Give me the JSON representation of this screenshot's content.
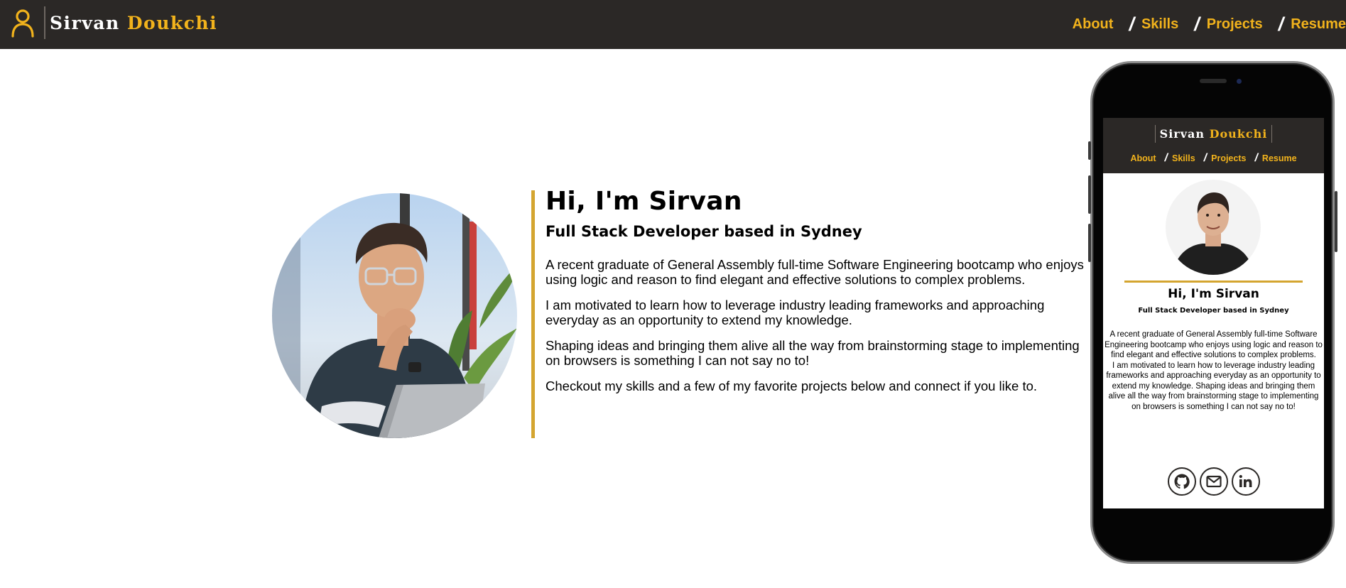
{
  "site": {
    "first_name": "Sirvan",
    "last_name": "Doukchi",
    "brand_icon": "user-icon"
  },
  "nav": {
    "separator": "/",
    "items": [
      {
        "label": "About"
      },
      {
        "label": "Skills"
      },
      {
        "label": "Projects"
      },
      {
        "label": "Resume"
      }
    ]
  },
  "hero": {
    "title": "Hi, I'm Sirvan",
    "subtitle": "Full Stack Developer based in Sydney",
    "paragraphs": [
      "A recent graduate of General Assembly full-time Software Engineering bootcamp who enjoys using logic and reason to find elegant and effective solutions to complex problems.",
      "I am motivated to learn how to leverage industry leading frameworks and approaching everyday as an opportunity to extend my knowledge.",
      "Shaping ideas and bringing them alive all the way from brainstorming stage to implementing on browsers is something I can not say no to!",
      "Checkout my skills and a few of my favorite projects below and connect if you like to."
    ]
  },
  "mobile_preview": {
    "body_line_1": "A recent graduate of General Assembly full-time Software Engineering bootcamp who enjoys using logic and reason to find elegant and effective solutions to complex problems.",
    "body_line_2": "I am motivated to learn how to leverage industry leading frameworks and approaching everyday as an opportunity to extend my knowledge. Shaping ideas and bringing them alive all the way from brainstorming stage to implementing on browsers is something I can not say no to!",
    "socials": [
      "github-icon",
      "email-icon",
      "linkedin-icon"
    ]
  },
  "colors": {
    "header_bg": "#2b2826",
    "accent": "#f2b31c",
    "accent_bar": "#d4a530"
  }
}
